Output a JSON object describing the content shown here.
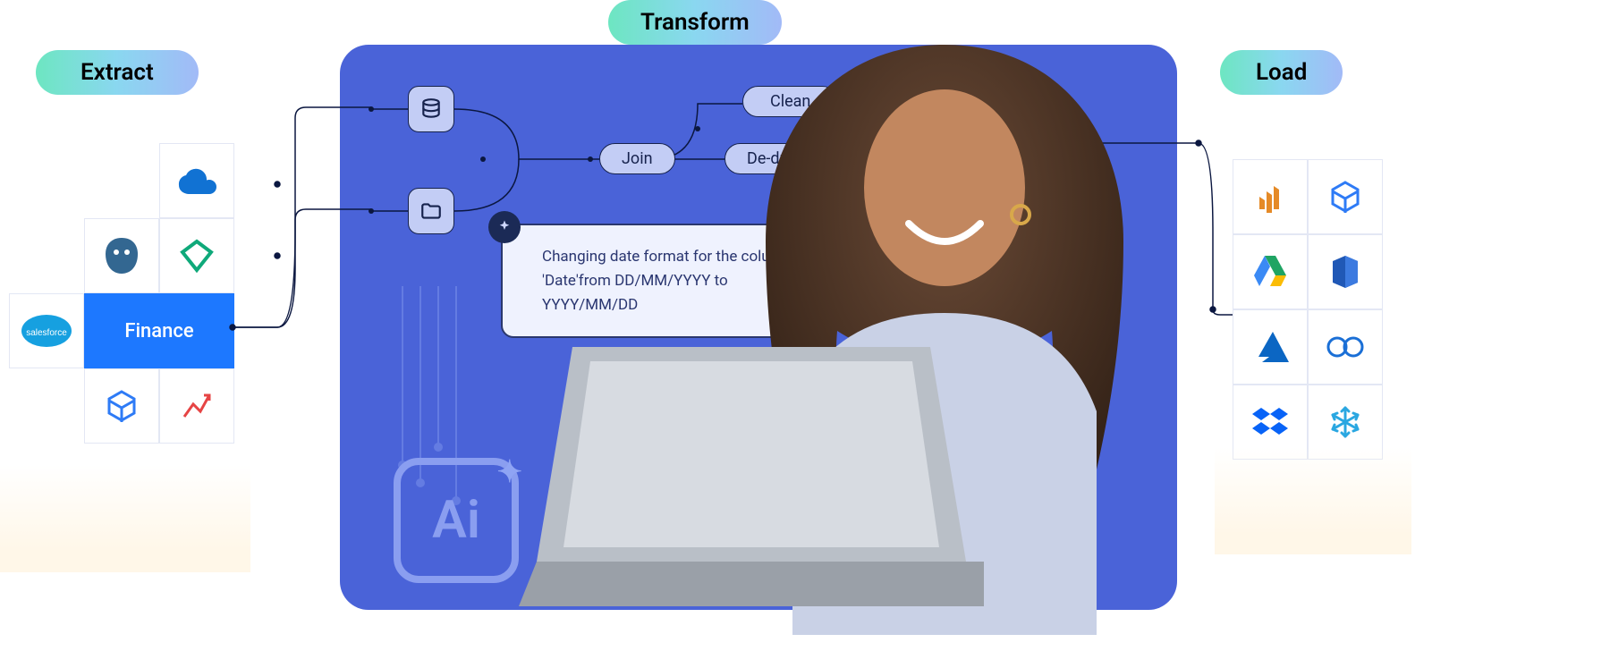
{
  "labels": {
    "extract": "Extract",
    "transform": "Transform",
    "load": "Load"
  },
  "pipeline": {
    "db_node": "database-icon",
    "folder_node": "folder-icon",
    "join": "Join",
    "clean": "Clean",
    "dedup": "De-duplicate"
  },
  "prompt": {
    "text": "Changing date format for the column 'Date'from DD/MM/YYYY to YYYY/MM/DD",
    "badge": "zia-icon",
    "send": "send-icon"
  },
  "ai_badge": "Ai",
  "extract_sources": {
    "onedrive": "onedrive-icon",
    "postgres": "postgres-icon",
    "zoho_dataprep": "dataprep-icon",
    "salesforce": "salesforce",
    "finance_label": "Finance",
    "storage": "storage-icon",
    "analytics": "analytics-icon"
  },
  "load_targets": {
    "aws_s3": "aws-s3-icon",
    "bigquery": "bigquery-icon",
    "gdrive": "gdrive-icon",
    "redshift": "redshift-icon",
    "azure": "azure-icon",
    "zoho_crm": "zoho-crm-icon",
    "dropbox": "dropbox-icon",
    "snowflake": "snowflake-icon"
  }
}
